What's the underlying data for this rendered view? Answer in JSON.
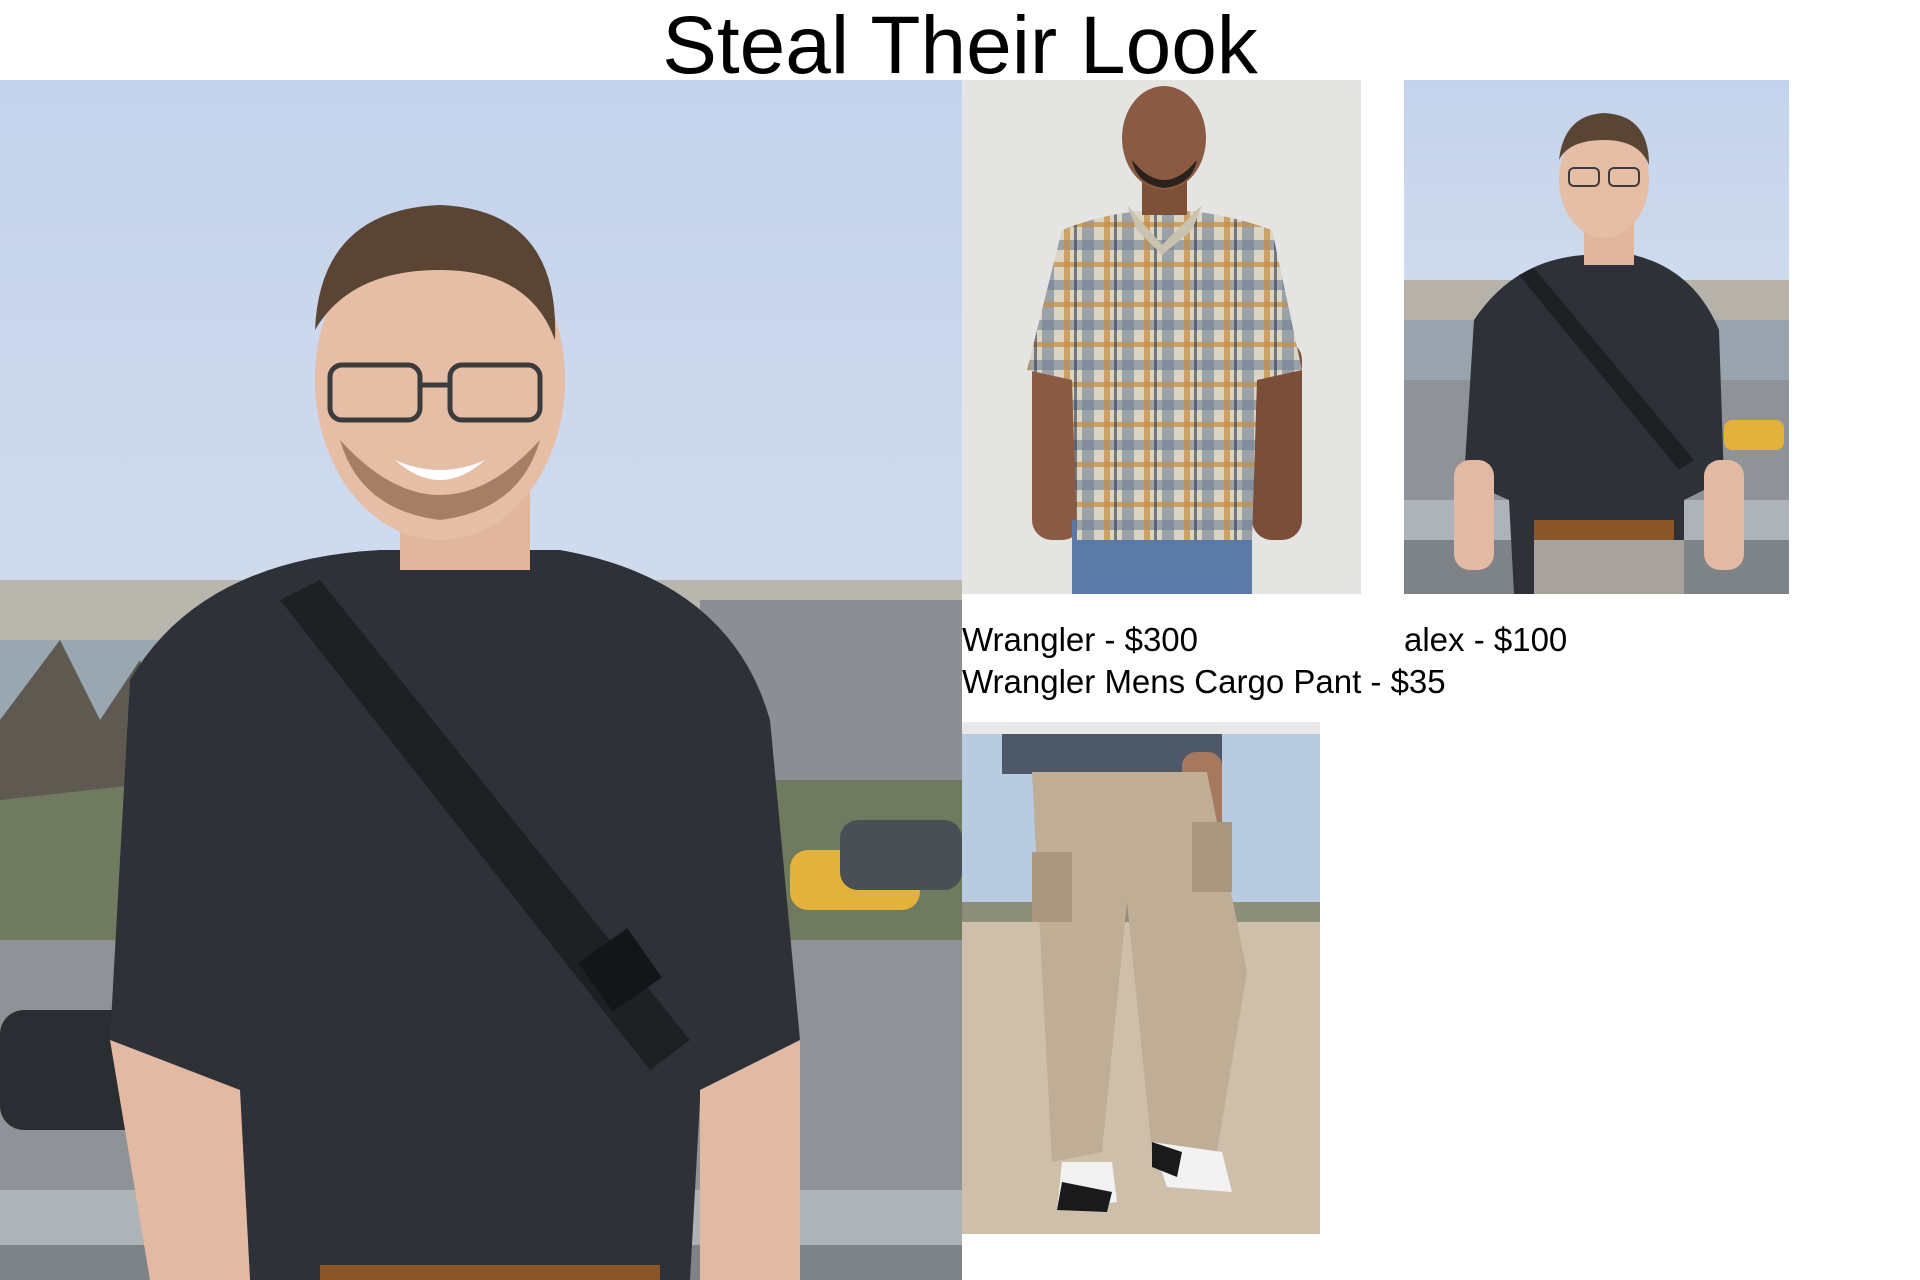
{
  "title": "Steal Their Look",
  "photos": {
    "main": {
      "icon": "person-photo"
    },
    "shirt": {
      "icon": "plaid-shirt-product-photo"
    },
    "alex": {
      "icon": "person-photo"
    },
    "pants": {
      "icon": "cargo-pants-product-photo"
    }
  },
  "captions": {
    "shirt": "Wrangler - $300",
    "alex": "alex - $100",
    "pants": "Wrangler Mens Cargo Pant - $35"
  },
  "colors": {
    "sky": "#c9d6ea",
    "shirt_dark": "#2e3238",
    "belt": "#8a5527",
    "pants_khaki": "#bfae95",
    "plaid_base": "#d9d4c4"
  }
}
